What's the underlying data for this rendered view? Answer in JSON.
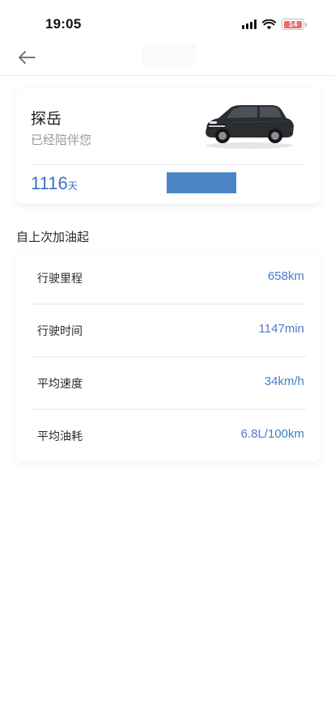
{
  "status_bar": {
    "time": "19:05",
    "battery_level": "14",
    "battery_fraction": 0.14,
    "battery_color": "#e86b6b",
    "icons": [
      "signal-icon",
      "wifi-icon",
      "battery-icon"
    ]
  },
  "nav": {
    "back_icon": "arrow-left-icon"
  },
  "vehicle": {
    "name": "探岳",
    "subtitle": "已经陪伴您",
    "days": "1116",
    "days_unit": "天",
    "image": "car-suv-image"
  },
  "section_title": "自上次加油起",
  "stats": [
    {
      "label": "行驶里程",
      "value": "658km"
    },
    {
      "label": "行驶时间",
      "value": "1147min"
    },
    {
      "label": "平均速度",
      "value": "34km/h"
    },
    {
      "label": "平均油耗",
      "value": "6.8L/100km"
    }
  ],
  "colors": {
    "accent": "#3a73c3",
    "value_text": "#4a7cc6",
    "redaction": "#4a86c6"
  }
}
